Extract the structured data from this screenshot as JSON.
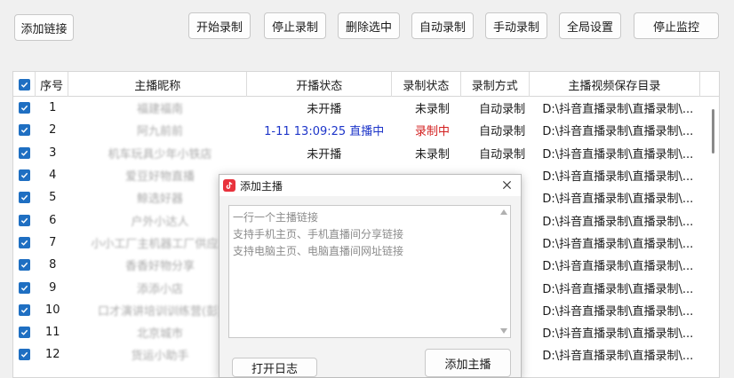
{
  "toolbar": {
    "add_link": "添加链接",
    "start_record": "开始录制",
    "stop_record": "停止录制",
    "delete_selected": "删除选中",
    "auto_record": "自动录制",
    "manual_record": "手动录制",
    "global_settings": "全局设置",
    "stop_monitor": "停止监控"
  },
  "table": {
    "headers": [
      "序号",
      "主播昵称",
      "开播状态",
      "录制状态",
      "录制方式",
      "主播视频保存目录"
    ],
    "rows": [
      {
        "index": "1",
        "name": "福建福南",
        "live": "未开播",
        "rec": "未录制",
        "mode": "自动录制",
        "dir": "D:\\抖音直播录制\\直播录制\\..."
      },
      {
        "index": "2",
        "name": "阿九前前",
        "live": "1-11 13:09:25 直播中",
        "rec": "录制中",
        "mode": "自动录制",
        "dir": "D:\\抖音直播录制\\直播录制\\..."
      },
      {
        "index": "3",
        "name": "机车玩具少年小铁店",
        "live": "未开播",
        "rec": "未录制",
        "mode": "自动录制",
        "dir": "D:\\抖音直播录制\\直播录制\\..."
      },
      {
        "index": "4",
        "name": "爱豆好物直播",
        "live": "",
        "rec": "",
        "mode": "",
        "dir": "D:\\抖音直播录制\\直播录制\\..."
      },
      {
        "index": "5",
        "name": "鲸选好器",
        "live": "",
        "rec": "",
        "mode": "",
        "dir": "D:\\抖音直播录制\\直播录制\\..."
      },
      {
        "index": "6",
        "name": "户外小达人",
        "live": "",
        "rec": "",
        "mode": "",
        "dir": "D:\\抖音直播录制\\直播录制\\..."
      },
      {
        "index": "7",
        "name": "小小工厂主机器工厂供应...",
        "live": "",
        "rec": "",
        "mode": "",
        "dir": "D:\\抖音直播录制\\直播录制\\..."
      },
      {
        "index": "8",
        "name": "香香好物分享",
        "live": "",
        "rec": "",
        "mode": "",
        "dir": "D:\\抖音直播录制\\直播录制\\..."
      },
      {
        "index": "9",
        "name": "添添小店",
        "live": "",
        "rec": "",
        "mode": "",
        "dir": "D:\\抖音直播录制\\直播录制\\..."
      },
      {
        "index": "10",
        "name": "口才演讲培训训练营(彭)",
        "live": "",
        "rec": "",
        "mode": "",
        "dir": "D:\\抖音直播录制\\直播录制\\..."
      },
      {
        "index": "11",
        "name": "北京城市",
        "live": "",
        "rec": "",
        "mode": "",
        "dir": "D:\\抖音直播录制\\直播录制\\..."
      },
      {
        "index": "12",
        "name": "货运小助手",
        "live": "",
        "rec": "",
        "mode": "",
        "dir": "D:\\抖音直播录制\\直播录制\\..."
      }
    ]
  },
  "dialog": {
    "title": "添加主播",
    "placeholder_lines": [
      "一行一个主播链接",
      "支持手机主页、手机直播间分享链接",
      "支持电脑主页、电脑直播间网址链接"
    ],
    "open_log": "打开日志",
    "add_anchor": "添加主播"
  },
  "colors": {
    "accent": "#1f6fc2",
    "live": "#1d35c9",
    "recording": "#d31f1f",
    "app_icon": "#e8323c"
  }
}
